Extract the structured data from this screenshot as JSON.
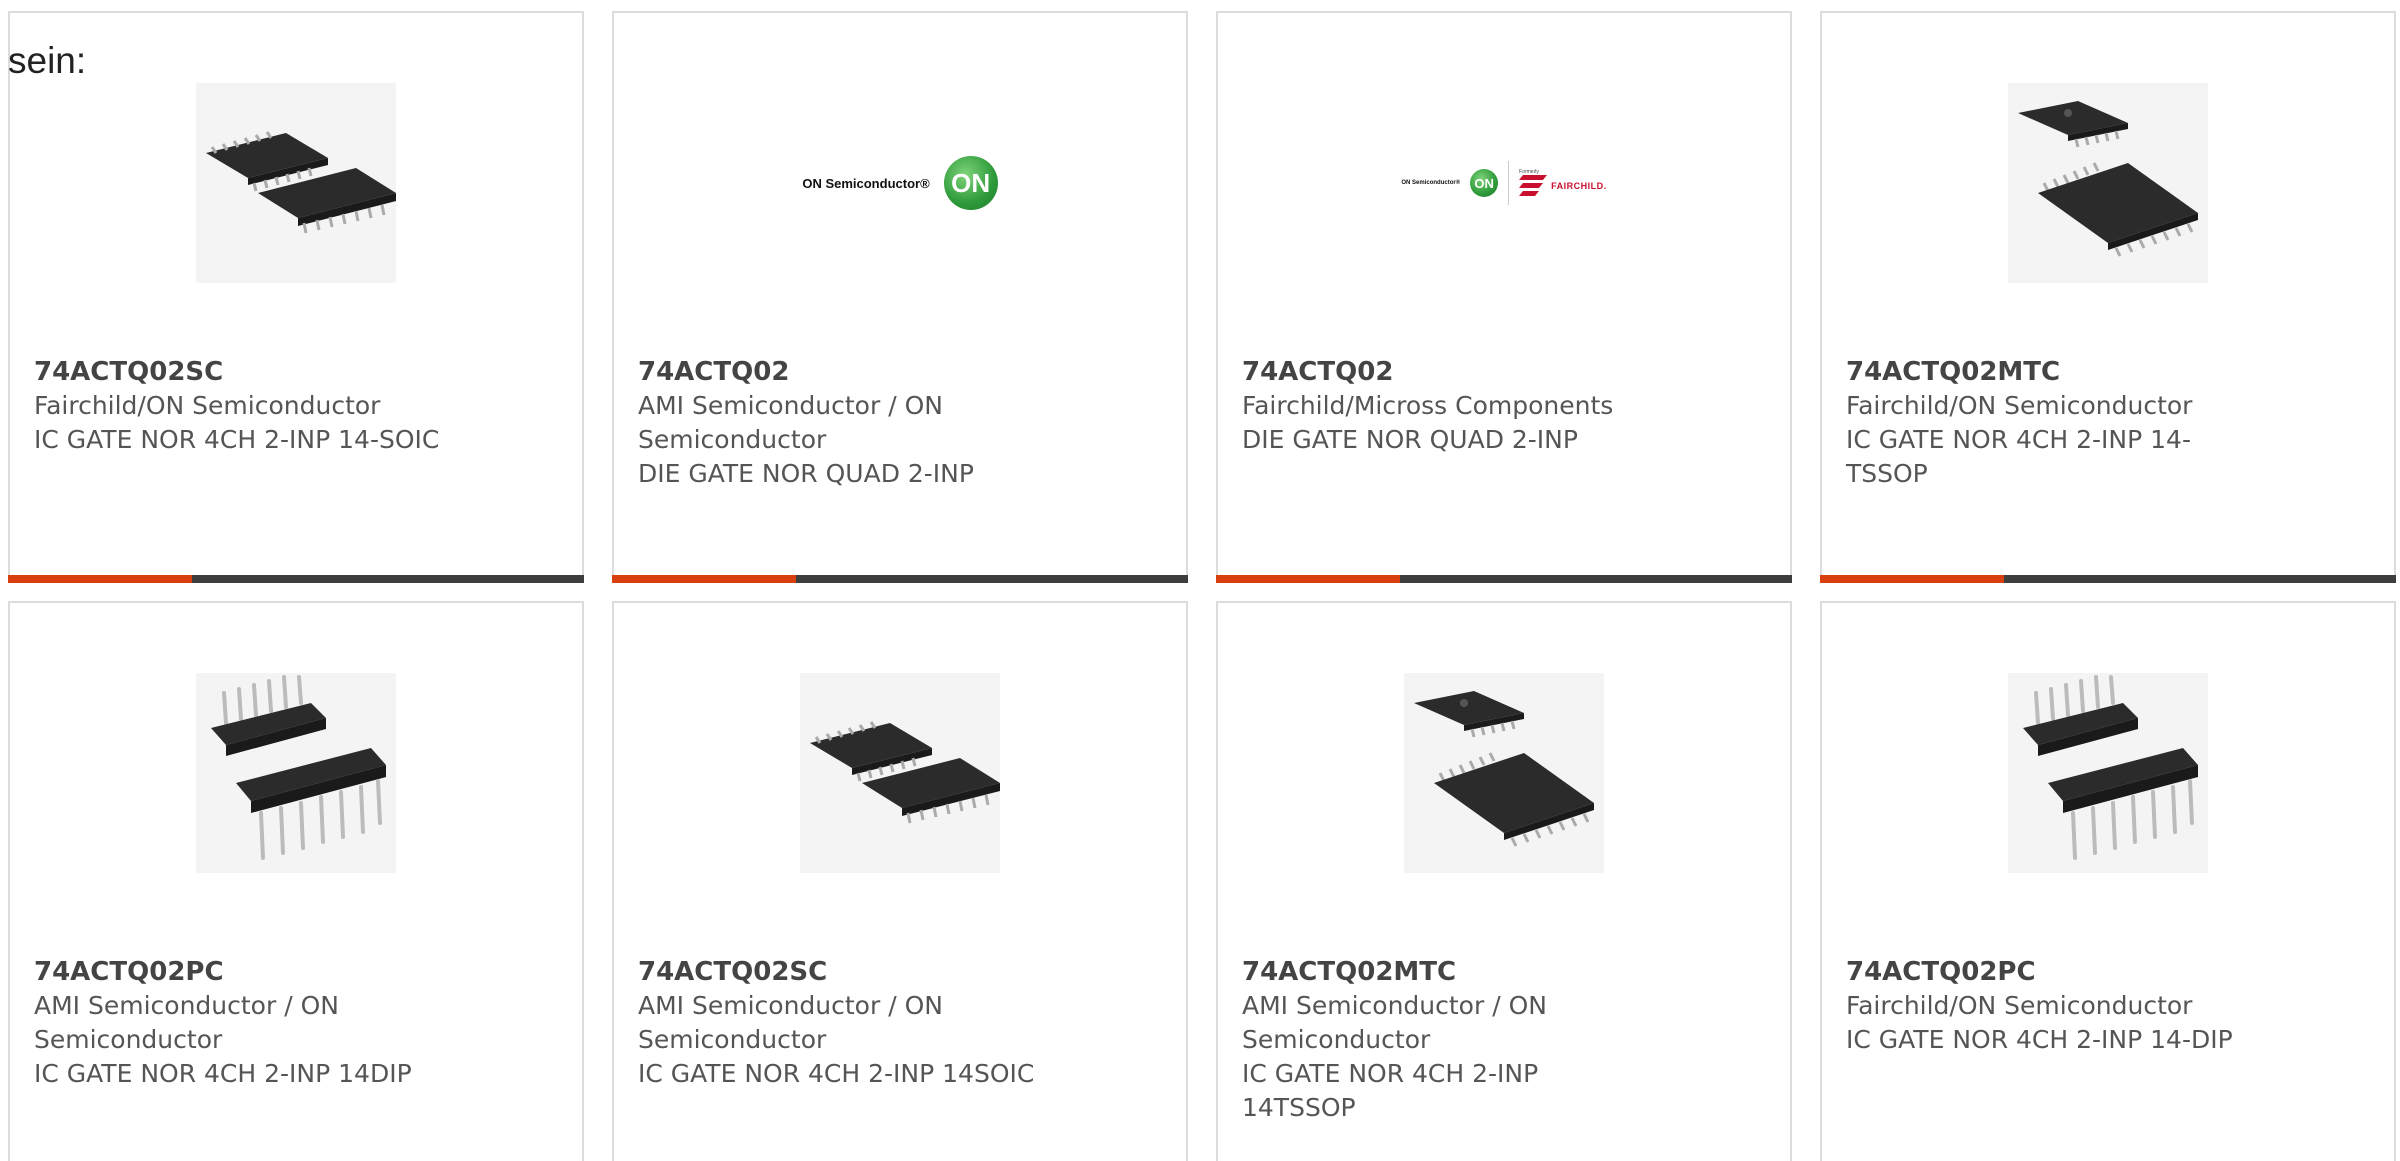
{
  "intro_text": "sein:",
  "colors": {
    "accent": "#d8400e",
    "bar_dark": "#3d3d3d",
    "card_border": "#dcdcdc",
    "on_green": "#2d9a3a",
    "fairchild_red": "#c8102e"
  },
  "cards": [
    {
      "part_number": "74ACTQ02SC",
      "manufacturer": "Fairchild/ON Semiconductor",
      "description": "IC GATE NOR 4CH 2-INP 14-SOIC",
      "image": "soic-package-icon"
    },
    {
      "part_number": "74ACTQ02",
      "manufacturer": "AMI Semiconductor / ON Semiconductor",
      "description": "DIE GATE NOR QUAD 2-INP",
      "image": "on-semiconductor-logo",
      "logo_text": "ON Semiconductor®",
      "logo_badge": "ON"
    },
    {
      "part_number": "74ACTQ02",
      "manufacturer": "Fairchild/Micross Components",
      "description": "DIE GATE NOR QUAD 2-INP",
      "image": "on-fairchild-logo",
      "logo_text": "ON Semiconductor®",
      "logo_badge": "ON",
      "formerly_text": "Formerly",
      "fairchild_text": "FAIRCHILD."
    },
    {
      "part_number": "74ACTQ02MTC",
      "manufacturer": "Fairchild/ON Semiconductor",
      "description": "IC GATE NOR 4CH 2-INP 14-TSSOP",
      "image": "tssop-package-icon"
    },
    {
      "part_number": "74ACTQ02PC",
      "manufacturer": "AMI Semiconductor / ON Semiconductor",
      "description": "IC GATE NOR 4CH 2-INP 14DIP",
      "image": "dip-package-icon"
    },
    {
      "part_number": "74ACTQ02SC",
      "manufacturer": "AMI Semiconductor / ON Semiconductor",
      "description": "IC GATE NOR 4CH 2-INP 14SOIC",
      "image": "soic-package-icon"
    },
    {
      "part_number": "74ACTQ02MTC",
      "manufacturer": "AMI Semiconductor / ON Semiconductor",
      "description": "IC GATE NOR 4CH 2-INP 14TSSOP",
      "image": "tssop-package-icon"
    },
    {
      "part_number": "74ACTQ02PC",
      "manufacturer": "Fairchild/ON Semiconductor",
      "description": "IC GATE NOR 4CH 2-INP 14-DIP",
      "image": "dip-package-icon"
    }
  ]
}
